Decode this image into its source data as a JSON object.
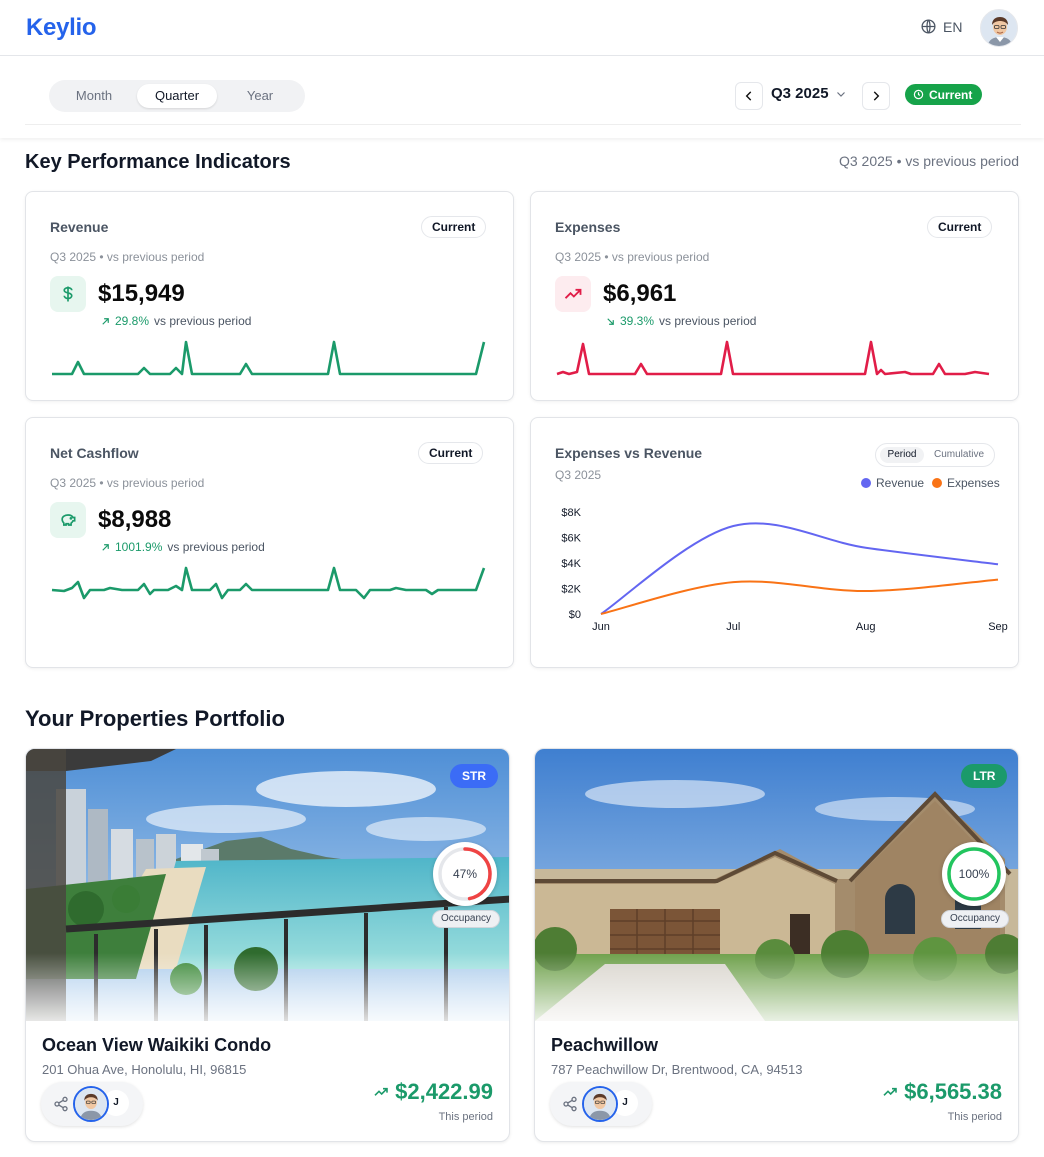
{
  "app": {
    "logo": "Keylio",
    "language": "EN"
  },
  "filters": {
    "tabs": [
      "Month",
      "Quarter",
      "Year"
    ],
    "active_tab": "Quarter",
    "period": "Q3 2025",
    "status_label": "Current"
  },
  "kpi_section": {
    "title": "Key Performance Indicators",
    "subtitle": "Q3 2025 • vs previous period"
  },
  "kpis": {
    "revenue": {
      "title": "Revenue",
      "badge": "Current",
      "period": "Q3 2025 • vs previous period",
      "value": "$15,949",
      "change_pct": "29.8%",
      "change_text": "vs previous period",
      "trend": "up",
      "color": "#1b9a6a",
      "icon": "dollar-icon"
    },
    "expenses": {
      "title": "Expenses",
      "badge": "Current",
      "period": "Q3 2025 • vs previous period",
      "value": "$6,961",
      "change_pct": "39.3%",
      "change_text": "vs previous period",
      "trend": "down",
      "color": "#e11d48",
      "icon": "trending-up-icon"
    },
    "cashflow": {
      "title": "Net Cashflow",
      "badge": "Current",
      "period": "Q3 2025 • vs previous period",
      "value": "$8,988",
      "change_pct": "1001.9%",
      "change_text": "vs previous period",
      "trend": "up",
      "color": "#1b9a6a",
      "icon": "piggy-bank-icon"
    }
  },
  "comparison": {
    "title": "Expenses vs Revenue",
    "period": "Q3 2025",
    "toggle": [
      "Period",
      "Cumulative"
    ],
    "active_toggle": "Period"
  },
  "chart_data": {
    "type": "line",
    "title": "Expenses vs Revenue",
    "subtitle": "Q3 2025",
    "x": [
      "Jun",
      "Jul",
      "Aug",
      "Sep"
    ],
    "yticks": [
      "$0",
      "$2K",
      "$4K",
      "$6K",
      "$8K"
    ],
    "ylim": [
      0,
      8000
    ],
    "legend_position": "top-right",
    "grid": false,
    "series": [
      {
        "name": "Revenue",
        "color": "#6366f1",
        "values": [
          0,
          6900,
          5200,
          3900
        ]
      },
      {
        "name": "Expenses",
        "color": "#f97316",
        "values": [
          0,
          2500,
          1800,
          2700
        ]
      }
    ]
  },
  "properties_section": {
    "title": "Your Properties Portfolio"
  },
  "properties": [
    {
      "name": "Ocean View Waikiki Condo",
      "address": "201 Ohua Ave, Honolulu, HI, 96815",
      "type": "STR",
      "type_color": "#3b6cf6",
      "occupancy": 47,
      "occupancy_text": "47%",
      "occupancy_color": "#ef4444",
      "occupancy_label": "Occupancy",
      "owner_initial": "J",
      "amount": "$2,422.99",
      "amount_label": "This period"
    },
    {
      "name": "Peachwillow",
      "address": "787 Peachwillow Dr, Brentwood, CA, 94513",
      "type": "LTR",
      "type_color": "#1b9a6a",
      "occupancy": 100,
      "occupancy_text": "100%",
      "occupancy_color": "#22c55e",
      "occupancy_label": "Occupancy",
      "owner_initial": "J",
      "amount": "$6,565.38",
      "amount_label": "This period"
    }
  ]
}
